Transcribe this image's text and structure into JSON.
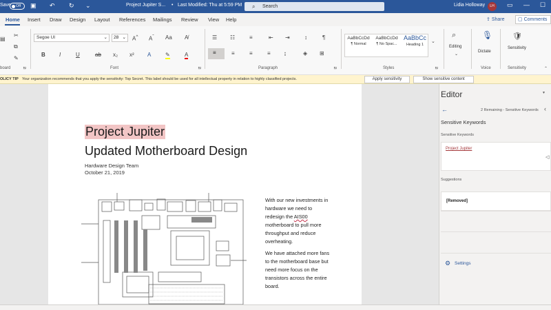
{
  "titlebar": {
    "autosave_label": "Save",
    "autosave_state": "Off",
    "doc_title": "Project Jupiter S...",
    "last_modified": "Last Modified: Thu at 5:59 PM",
    "search_placeholder": "Search",
    "user_name": "Lidia Holloway",
    "user_initials": "LH"
  },
  "tabs": [
    "Home",
    "Insert",
    "Draw",
    "Design",
    "Layout",
    "References",
    "Mailings",
    "Review",
    "View",
    "Help"
  ],
  "actions": {
    "share": "Share",
    "comments": "Comments"
  },
  "ribbon": {
    "font_name": "Segoe UI",
    "font_size": "28",
    "groups": {
      "clipboard": "board",
      "font": "Font",
      "paragraph": "Paragraph",
      "styles": "Styles",
      "voice": "Voice",
      "sensitivity": "Sensitivity"
    },
    "styles": [
      {
        "preview": "AaBbCcDd",
        "name": "¶ Normal"
      },
      {
        "preview": "AaBbCcDd",
        "name": "¶ No Spac..."
      },
      {
        "preview": "AaBbCc",
        "name": "Heading 1"
      }
    ],
    "editing": "Editing",
    "dictate": "Dictate",
    "sensitivity": "Sensitivity"
  },
  "policy": {
    "label": "OLICY TIP",
    "message": "Your organization recommends that you apply the sensitivity: Top Secret. This label should be used for all intellectual property in relation to highly classified projects.",
    "apply_button": "Apply sensitivity",
    "show_button": "Show sensitive content"
  },
  "document": {
    "title": "Project Jupiter",
    "subtitle": "Updated Motherboard Design",
    "team": "Hardware Design Team",
    "date": "October 21, 2019",
    "para1_a": "With our new investments in hardware we need to redesign the",
    "para1_kw": "AIS00",
    "para1_b": "motherboard to pull more throughput and reduce overheating.",
    "para2": "We have attached more fans to the motherboard base but need more focus on the transistors across the entire board."
  },
  "editor": {
    "title": "Editor",
    "remaining": "2 Remaining - Sensitive Keywords",
    "heading": "Sensitive Keywords",
    "kw_section": "Sensitive Keywords",
    "keyword": "Project Jupiter",
    "suggestions": "Suggestions",
    "removed": "[Removed]",
    "settings": "Settings"
  },
  "colors": {
    "word_blue": "#2b579a",
    "policy_bg": "#fff4ce",
    "highlight": "#f2c5c5"
  }
}
